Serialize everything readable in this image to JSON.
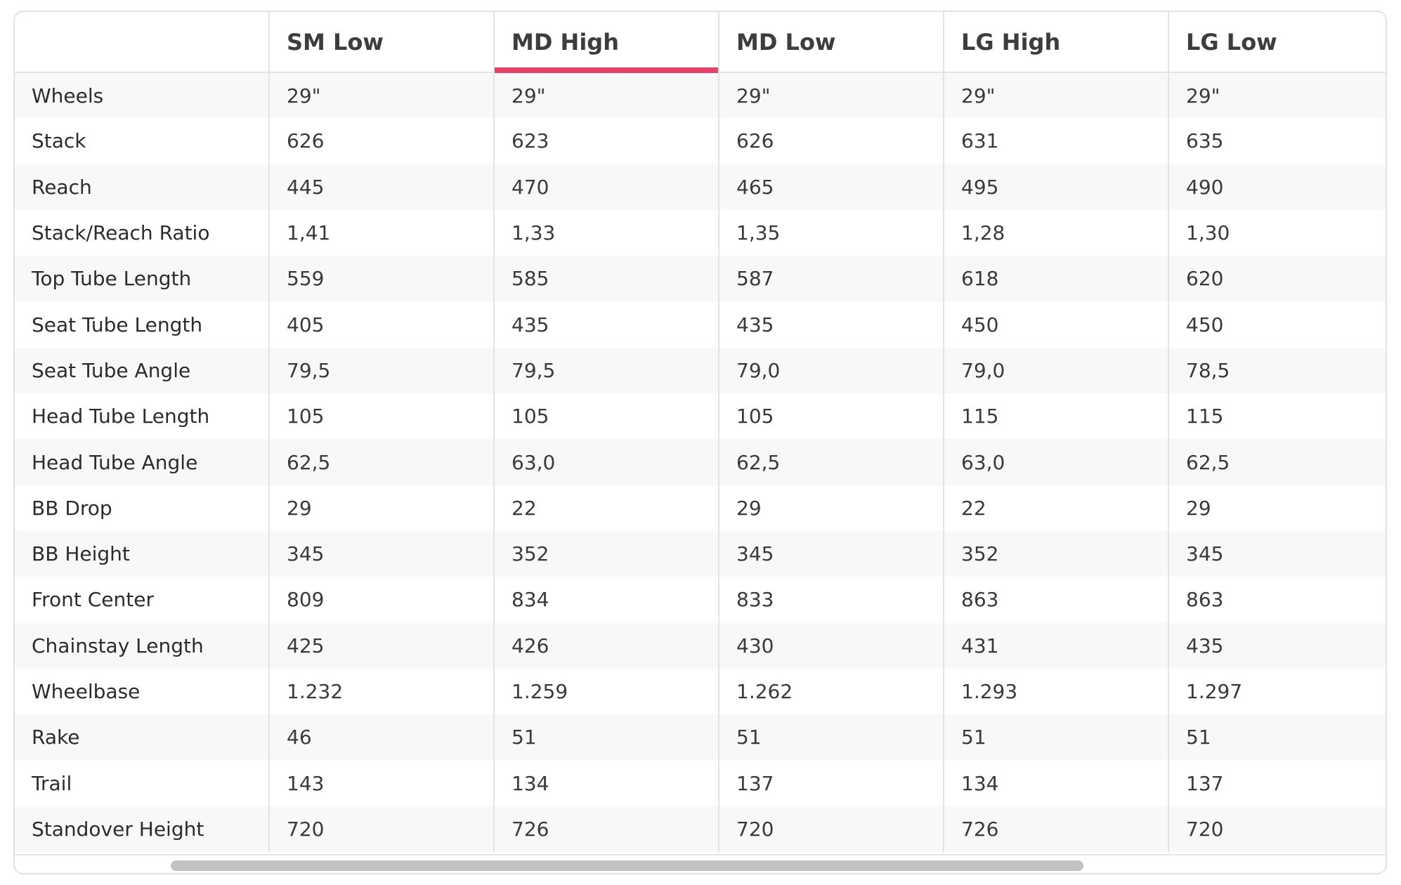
{
  "table": {
    "headers": [
      "",
      "SM Low",
      "MD High",
      "MD Low",
      "LG High",
      "LG Low"
    ],
    "active_header": "MD High",
    "rows": [
      {
        "label": "Wheels",
        "values": [
          "29\"",
          "29\"",
          "29\"",
          "29\"",
          "29\""
        ]
      },
      {
        "label": "Stack",
        "values": [
          "626",
          "623",
          "626",
          "631",
          "635"
        ]
      },
      {
        "label": "Reach",
        "values": [
          "445",
          "470",
          "465",
          "495",
          "490"
        ]
      },
      {
        "label": "Stack/Reach Ratio",
        "values": [
          "1,41",
          "1,33",
          "1,35",
          "1,28",
          "1,30"
        ]
      },
      {
        "label": "Top Tube Length",
        "values": [
          "559",
          "585",
          "587",
          "618",
          "620"
        ]
      },
      {
        "label": "Seat Tube Length",
        "values": [
          "405",
          "435",
          "435",
          "450",
          "450"
        ]
      },
      {
        "label": "Seat Tube Angle",
        "values": [
          "79,5",
          "79,5",
          "79,0",
          "79,0",
          "78,5"
        ]
      },
      {
        "label": "Head Tube Length",
        "values": [
          "105",
          "105",
          "105",
          "115",
          "115"
        ]
      },
      {
        "label": "Head Tube Angle",
        "values": [
          "62,5",
          "63,0",
          "62,5",
          "63,0",
          "62,5"
        ]
      },
      {
        "label": "BB Drop",
        "values": [
          "29",
          "22",
          "29",
          "22",
          "29"
        ]
      },
      {
        "label": "BB Height",
        "values": [
          "345",
          "352",
          "345",
          "352",
          "345"
        ]
      },
      {
        "label": "Front Center",
        "values": [
          "809",
          "834",
          "833",
          "863",
          "863"
        ]
      },
      {
        "label": "Chainstay Length",
        "values": [
          "425",
          "426",
          "430",
          "431",
          "435"
        ]
      },
      {
        "label": "Wheelbase",
        "values": [
          "1.232",
          "1.259",
          "1.262",
          "1.293",
          "1.297"
        ]
      },
      {
        "label": "Rake",
        "values": [
          "46",
          "51",
          "51",
          "51",
          "51"
        ]
      },
      {
        "label": "Trail",
        "values": [
          "143",
          "134",
          "137",
          "134",
          "137"
        ]
      },
      {
        "label": "Standover Height",
        "values": [
          "720",
          "726",
          "720",
          "726",
          "720"
        ]
      }
    ]
  },
  "colors": {
    "accent": "#e8426a",
    "stripe": "#f8f8f8",
    "border": "#e4e4e4",
    "scroll_thumb": "#c2c2c2"
  }
}
